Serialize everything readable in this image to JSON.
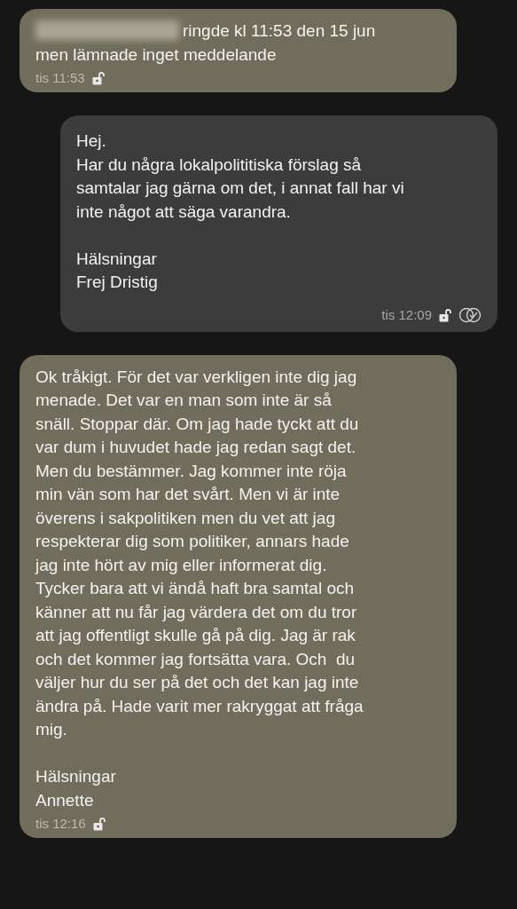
{
  "messages": [
    {
      "kind": "incoming",
      "redacted": true,
      "text": "ringde kl 11:53 den 15 jun\nmen lämnade inget meddelande",
      "time": "tis 11:53",
      "delivered": false
    },
    {
      "kind": "outgoing",
      "redacted": false,
      "text": "Hej.\nHar du några lokalpolititiska förslag så\nsamtalar jag gärna om det, i annat fall har vi\ninte något att säga varandra.\n\nHälsningar\nFrej Dristig",
      "time": "tis 12:09",
      "delivered": true
    },
    {
      "kind": "incoming",
      "redacted": false,
      "text": "Ok tråkigt. För det var verkligen inte dig jag\nmenade. Det var en man som inte är så\nsnäll. Stoppar där. Om jag hade tyckt att du\nvar dum i huvudet hade jag redan sagt det.\nMen du bestämmer. Jag kommer inte röja\nmin vän som har det svårt. Men vi är inte\növerens i sakpolitiken men du vet att jag\nrespekterar dig som politiker, annars hade\njag inte hört av mig eller informerat dig.\nTycker bara att vi ändå haft bra samtal och\nkänner att nu får jag värdera det om du tror\natt jag offentligt skulle gå på dig. Jag är rak\noch det kommer jag fortsätta vara. Och  du\nväljer hur du ser på det och det kan jag inte\nändra på. Hade varit mer rakryggat att fråga\nmig.\n\nHälsningar\nAnnette",
      "time": "tis 12:16",
      "delivered": false
    }
  ]
}
